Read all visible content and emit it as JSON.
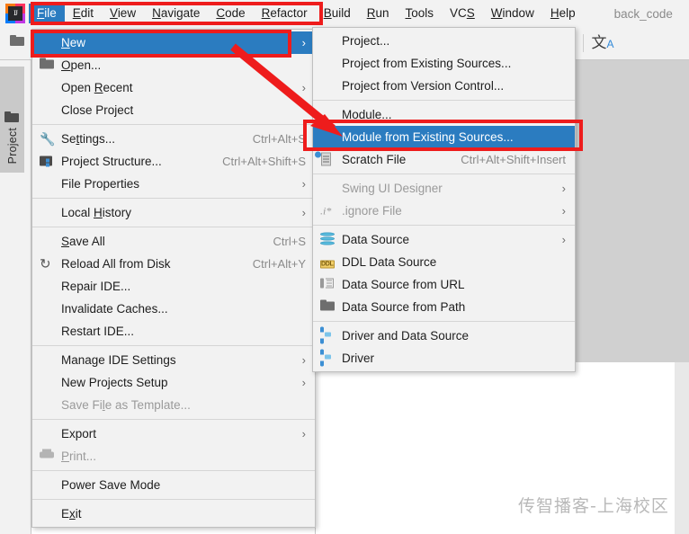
{
  "window": {
    "project_name": "back_code",
    "logo_text": "IJ",
    "watermark": "传智播客-上海校区"
  },
  "menubar": {
    "items": [
      {
        "label": "File",
        "mnemonic": "F",
        "active": true
      },
      {
        "label": "Edit",
        "mnemonic": "E",
        "active": false
      },
      {
        "label": "View",
        "mnemonic": "V",
        "active": false
      },
      {
        "label": "Navigate",
        "mnemonic": "N",
        "active": false
      },
      {
        "label": "Code",
        "mnemonic": "C",
        "active": false
      },
      {
        "label": "Refactor",
        "mnemonic": "R",
        "active": false
      },
      {
        "label": "Build",
        "mnemonic": "B",
        "active": false
      },
      {
        "label": "Run",
        "mnemonic": "R",
        "active": false
      },
      {
        "label": "Tools",
        "mnemonic": "T",
        "active": false
      },
      {
        "label": "VCS",
        "mnemonic": "S",
        "active": false
      },
      {
        "label": "Window",
        "mnemonic": "W",
        "active": false
      },
      {
        "label": "Help",
        "mnemonic": "H",
        "active": false
      }
    ]
  },
  "toolbar": {
    "open_folder_icon": "folder-icon",
    "translate_icon_text": "文",
    "translate_icon_sub": "A"
  },
  "left_strip": {
    "project_tab_label": "Project",
    "project_tab_icon": "folder-icon"
  },
  "file_menu": {
    "items": [
      {
        "label": "New",
        "mnemonic": "N",
        "icon": "",
        "accel": "",
        "arrow": "›",
        "selected": true,
        "disabled": false
      },
      {
        "label": "Open...",
        "mnemonic": "O",
        "icon": "folder-icon",
        "accel": "",
        "arrow": "",
        "selected": false,
        "disabled": false
      },
      {
        "label": "Open Recent",
        "mnemonic": "R",
        "icon": "",
        "accel": "",
        "arrow": "›",
        "selected": false,
        "disabled": false
      },
      {
        "label": "Close Project",
        "mnemonic": "",
        "icon": "",
        "accel": "",
        "arrow": "",
        "selected": false,
        "disabled": false
      },
      {
        "separator": true
      },
      {
        "label": "Settings...",
        "mnemonic": "t",
        "icon": "wrench-icon",
        "accel": "Ctrl+Alt+S",
        "arrow": "",
        "selected": false,
        "disabled": false
      },
      {
        "label": "Project Structure...",
        "mnemonic": "",
        "icon": "project-structure-icon",
        "accel": "Ctrl+Alt+Shift+S",
        "arrow": "",
        "selected": false,
        "disabled": false
      },
      {
        "label": "File Properties",
        "mnemonic": "",
        "icon": "",
        "accel": "",
        "arrow": "›",
        "selected": false,
        "disabled": false
      },
      {
        "separator": true
      },
      {
        "label": "Local History",
        "mnemonic": "H",
        "icon": "",
        "accel": "",
        "arrow": "›",
        "selected": false,
        "disabled": false
      },
      {
        "separator": true
      },
      {
        "label": "Save All",
        "mnemonic": "S",
        "icon": "save-icon",
        "accel": "Ctrl+S",
        "arrow": "",
        "selected": false,
        "disabled": false
      },
      {
        "label": "Reload All from Disk",
        "mnemonic": "",
        "icon": "reload-icon",
        "accel": "Ctrl+Alt+Y",
        "arrow": "",
        "selected": false,
        "disabled": false
      },
      {
        "label": "Repair IDE...",
        "mnemonic": "",
        "icon": "",
        "accel": "",
        "arrow": "",
        "selected": false,
        "disabled": false
      },
      {
        "label": "Invalidate Caches...",
        "mnemonic": "",
        "icon": "",
        "accel": "",
        "arrow": "",
        "selected": false,
        "disabled": false
      },
      {
        "label": "Restart IDE...",
        "mnemonic": "",
        "icon": "",
        "accel": "",
        "arrow": "",
        "selected": false,
        "disabled": false
      },
      {
        "separator": true
      },
      {
        "label": "Manage IDE Settings",
        "mnemonic": "",
        "icon": "",
        "accel": "",
        "arrow": "›",
        "selected": false,
        "disabled": false
      },
      {
        "label": "New Projects Setup",
        "mnemonic": "",
        "icon": "",
        "accel": "",
        "arrow": "›",
        "selected": false,
        "disabled": false
      },
      {
        "label": "Save File as Template...",
        "mnemonic": "l",
        "icon": "",
        "accel": "",
        "arrow": "",
        "selected": false,
        "disabled": true
      },
      {
        "separator": true
      },
      {
        "label": "Export",
        "mnemonic": "",
        "icon": "",
        "accel": "",
        "arrow": "›",
        "selected": false,
        "disabled": false
      },
      {
        "label": "Print...",
        "mnemonic": "P",
        "icon": "print-icon",
        "accel": "",
        "arrow": "",
        "selected": false,
        "disabled": true
      },
      {
        "separator": true
      },
      {
        "label": "Power Save Mode",
        "mnemonic": "",
        "icon": "",
        "accel": "",
        "arrow": "",
        "selected": false,
        "disabled": false
      },
      {
        "separator": true
      },
      {
        "label": "Exit",
        "mnemonic": "x",
        "icon": "",
        "accel": "",
        "arrow": "",
        "selected": false,
        "disabled": false
      }
    ]
  },
  "new_submenu": {
    "items": [
      {
        "label": "Project...",
        "icon": "",
        "accel": "",
        "arrow": "",
        "selected": false,
        "disabled": false
      },
      {
        "label": "Project from Existing Sources...",
        "icon": "",
        "accel": "",
        "arrow": "",
        "selected": false,
        "disabled": false
      },
      {
        "label": "Project from Version Control...",
        "icon": "",
        "accel": "",
        "arrow": "",
        "selected": false,
        "disabled": false
      },
      {
        "separator": true
      },
      {
        "label": "Module...",
        "icon": "",
        "accel": "",
        "arrow": "",
        "selected": false,
        "disabled": false
      },
      {
        "label": "Module from Existing Sources...",
        "icon": "",
        "accel": "",
        "arrow": "",
        "selected": true,
        "disabled": false
      },
      {
        "label": "Scratch File",
        "icon": "scratch-file-icon",
        "accel": "Ctrl+Alt+Shift+Insert",
        "arrow": "",
        "selected": false,
        "disabled": false
      },
      {
        "separator": true
      },
      {
        "label": "Swing UI Designer",
        "icon": "",
        "accel": "",
        "arrow": "›",
        "selected": false,
        "disabled": true
      },
      {
        "label": ".ignore File",
        "icon": "ignore-file-icon",
        "accel": "",
        "arrow": "›",
        "selected": false,
        "disabled": true
      },
      {
        "separator": true
      },
      {
        "label": "Data Source",
        "icon": "database-icon",
        "accel": "",
        "arrow": "›",
        "selected": false,
        "disabled": false
      },
      {
        "label": "DDL Data Source",
        "icon": "ddl-icon",
        "accel": "",
        "arrow": "",
        "selected": false,
        "disabled": false
      },
      {
        "label": "Data Source from URL",
        "icon": "url-icon",
        "accel": "",
        "arrow": "",
        "selected": false,
        "disabled": false
      },
      {
        "label": "Data Source from Path",
        "icon": "folder-icon",
        "accel": "",
        "arrow": "",
        "selected": false,
        "disabled": false
      },
      {
        "separator": true
      },
      {
        "label": "Driver and Data Source",
        "icon": "driver-icon",
        "accel": "",
        "arrow": "",
        "selected": false,
        "disabled": false
      },
      {
        "label": "Driver",
        "icon": "driver-icon",
        "accel": "",
        "arrow": "",
        "selected": false,
        "disabled": false
      }
    ]
  },
  "annotations": {
    "highlight_color": "#ee1c1c",
    "selection_color": "#2b7cc0",
    "boxes": [
      {
        "name": "menubar-highlight"
      },
      {
        "name": "new-item-highlight"
      },
      {
        "name": "module-from-existing-sources-highlight"
      }
    ],
    "arrow": {
      "name": "pointer-arrow",
      "from": "New",
      "to": "Module from Existing Sources..."
    }
  }
}
